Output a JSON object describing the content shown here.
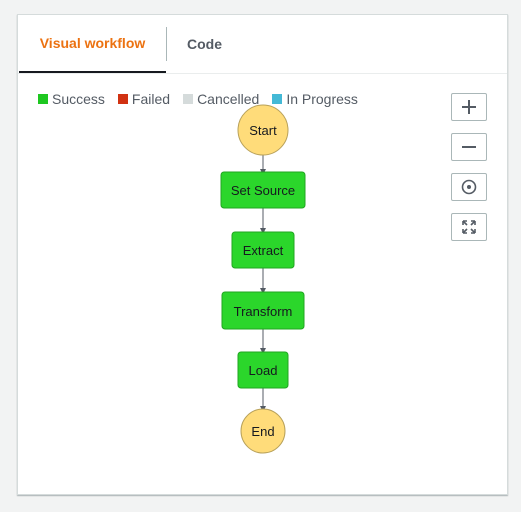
{
  "tabs": [
    {
      "label": "Visual workflow",
      "active": true
    },
    {
      "label": "Code",
      "active": false
    }
  ],
  "legend": [
    {
      "label": "Success",
      "color": "#1ec720"
    },
    {
      "label": "Failed",
      "color": "#d13212"
    },
    {
      "label": "Cancelled",
      "color": "#d5dbdb"
    },
    {
      "label": "In Progress",
      "color": "#44b9d6"
    }
  ],
  "controls": [
    {
      "name": "zoom-in-button",
      "icon": "plus-icon"
    },
    {
      "name": "zoom-out-button",
      "icon": "minus-icon"
    },
    {
      "name": "center-button",
      "icon": "target-icon"
    },
    {
      "name": "fit-button",
      "icon": "expand-icon"
    }
  ],
  "workflow": {
    "start": "Start",
    "steps": [
      "Set Source",
      "Extract",
      "Transform",
      "Load"
    ],
    "end": "End",
    "colors": {
      "state": "#2bd62b",
      "terminal": "#ffdc7a",
      "arrow": "#545b64"
    }
  }
}
